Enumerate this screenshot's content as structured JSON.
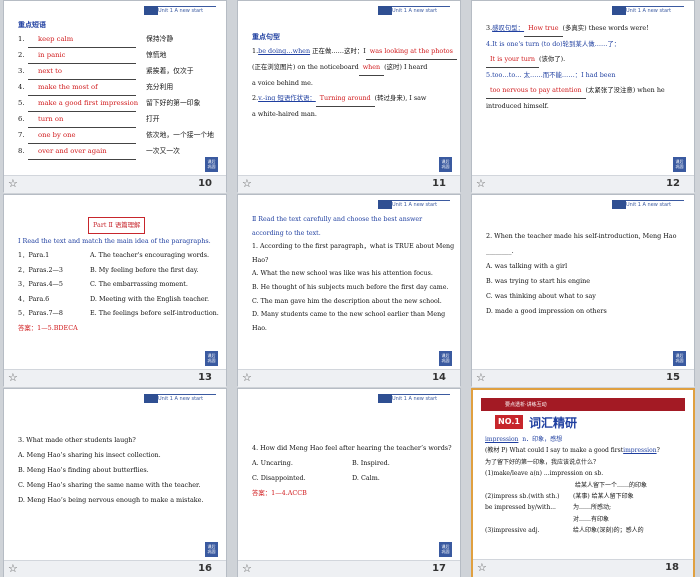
{
  "header_tag": "Unit 1   A new start",
  "corner_button": "课后 巩固",
  "slides": [
    {
      "page": "10",
      "heading": "重点短语",
      "phrases": [
        {
          "n": "1.",
          "ans": "keep calm",
          "zh": "保持冷静"
        },
        {
          "n": "2.",
          "ans": "in panic",
          "zh": "惊慌地"
        },
        {
          "n": "3.",
          "ans": "next to",
          "zh": "紧挨着，仅次于"
        },
        {
          "n": "4.",
          "ans": "make the most of",
          "zh": "充分利用"
        },
        {
          "n": "5.",
          "ans": "make a good first impression",
          "zh": "留下好的第一印象"
        },
        {
          "n": "6.",
          "ans": "turn on",
          "zh": "打开"
        },
        {
          "n": "7.",
          "ans": "one by one",
          "zh": "依次地，一个接一个地"
        },
        {
          "n": "8.",
          "ans": "over and over again",
          "zh": "一次又一次"
        }
      ]
    },
    {
      "page": "11",
      "heading": "重点句型",
      "l1a": "1.",
      "l1b": "be doing…when",
      "l1c": " 正在做……这时：I",
      "l1d": "was looking at the photos",
      "l2": "(正在浏览图片) on the noticeboard",
      "l2ans": "when",
      "l2b": "(这时) I heard",
      "l3": "a voice behind me.",
      "l4a": "2.",
      "l4b": "v.-ing 短语作状语：",
      "l4ans": "Turning around",
      "l4c": "(转过身来), I saw",
      "l5": "a white-haired man."
    },
    {
      "page": "12",
      "l1a": "3.",
      "l1b": "感叹句型：",
      "l1ans": "How true",
      "l1c": "(多真实) these words were!",
      "l2": "4.It is one's turn (to do)轮到某人做……了：",
      "l3ans": "It is your turn",
      "l3b": "(该你了).",
      "l4": "5.too…to…       太……而不能……：I had been",
      "l5ans": "too nervous to pay attention",
      "l5b": "(太紧张了没注意) when he",
      "l6": "introduced himself."
    },
    {
      "page": "13",
      "part": "Part Ⅱ  语篇理解",
      "instr": "Ⅰ  Read the text and match the main idea of the paragraphs.",
      "rows": [
        {
          "para": "1．Para.1",
          "idea": "A. The teacher's encouraging words."
        },
        {
          "para": "2．Paras.2—3",
          "idea": "B.  My feeling before the first day."
        },
        {
          "para": "3．Paras.4—5",
          "idea": "C.  The embarrassing moment."
        },
        {
          "para": "4．Para.6",
          "idea": "D.  Meeting with the English teacher."
        },
        {
          "para": "5．Paras.7—8",
          "idea": "E. The feelings before self-introduction."
        }
      ],
      "answer": "答案：1—5.BDECA"
    },
    {
      "page": "14",
      "instr1": "Ⅱ  Read the text carefully and choose the best answer",
      "instr2": "according to the text.",
      "q1": "1. According to the first paragraph，what is TRUE about Meng",
      "q1b": "Hao?",
      "opts": [
        "A.  What the new school was like was his attention focus.",
        "B.  He thought of his subjects much before the first day came.",
        "C.  The man gave him the description about the new school.",
        "D.  Many students came to the new school earlier than Meng"
      ],
      "tail": "Hao."
    },
    {
      "page": "15",
      "q1": "2.  When the teacher made his self-introduction, Meng Hao",
      "q2": "________.",
      "opts": [
        "A.  was talking with a girl",
        "B.  was trying to start his engine",
        "C.  was thinking about what to say",
        "D.  made a good impression on others"
      ]
    },
    {
      "page": "16",
      "q": "3.  What made other students laugh?",
      "opts": [
        "A.  Meng Hao’s sharing his insect collection.",
        "B.  Meng Hao’s finding about butterflies.",
        "C.  Meng Hao’s sharing the same name with the teacher.",
        "D.  Meng Hao’s being nervous enough to make a mistake."
      ]
    },
    {
      "page": "17",
      "q": "4.  How did Meng Hao feel after hearing the teacher’s words?",
      "optA": "A.  Uncaring.",
      "optB": "B.  Inspired.",
      "optC": "C.  Disappointed.",
      "optD": "D.  Calm.",
      "answer": "答案：1—4.ACCB"
    },
    {
      "page": "18",
      "banner": "要点透析·讲练互动",
      "title_badge": "NO.1",
      "title": "词汇精研",
      "head_word": "impression",
      "head_pos": "n．印象，感想",
      "ex1a": "(教材 P",
      "ex1b": ") What could I say to make a good first",
      "ex1c": "impression",
      "ex1d": "?",
      "ex2": "为了留下好的第一印象，我应该说点什么？",
      "u1a": "(1)make/leave a(n) ...impression on sb.",
      "u1b": "给某人留下一个……的印象",
      "u2a": "(2)impress sb.(with sth.)",
      "u2b": "(某事) 给某人留下印象",
      "u3a": "be impressed by/with...",
      "u3b": "为……所感动;",
      "u3c": "对……有印象",
      "u4a": "(3)impressive adj.",
      "u4b": "给人印象(深刻)的；感人的"
    }
  ]
}
